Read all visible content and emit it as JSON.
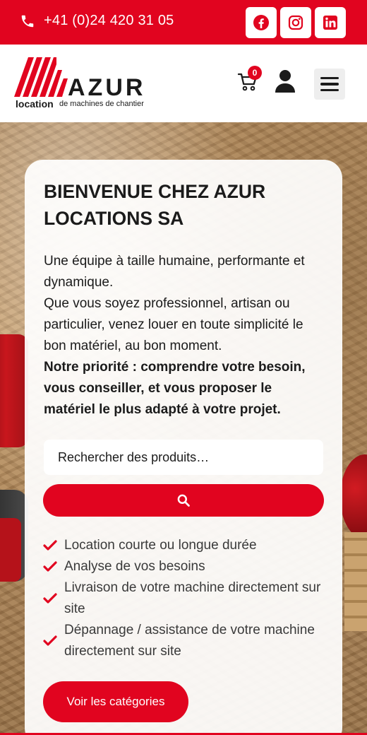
{
  "topbar": {
    "phone": "+41 (0)24 420 31 05",
    "social": [
      {
        "name": "facebook-icon"
      },
      {
        "name": "instagram-icon"
      },
      {
        "name": "linkedin-icon"
      }
    ],
    "accent_color": "#e1041f"
  },
  "header": {
    "logo": {
      "word": "AZUR",
      "tagline_bold": "location",
      "tagline_rest": "de machines de chantier"
    },
    "cart_count": "0"
  },
  "hero": {
    "title": "BIENVENUE CHEZ AZUR LOCATIONS SA",
    "paragraph_1": "Une équipe à taille humaine, performante et dynamique.",
    "paragraph_2": "Que vous soyez professionnel, artisan ou particulier, venez louer en toute simplicité le bon matériel, au bon moment.",
    "paragraph_bold": "Notre priorité : comprendre votre besoin, vous conseiller, et vous proposer le matériel le plus adapté à votre projet.",
    "search_placeholder": "Rechercher des produits…",
    "features": [
      "Location courte ou longue durée",
      "Analyse de vos besoins",
      "Livraison de votre machine directement sur site",
      "Dépannage / assistance de votre machine directement sur site"
    ],
    "cta_label": "Voir les catégories"
  }
}
